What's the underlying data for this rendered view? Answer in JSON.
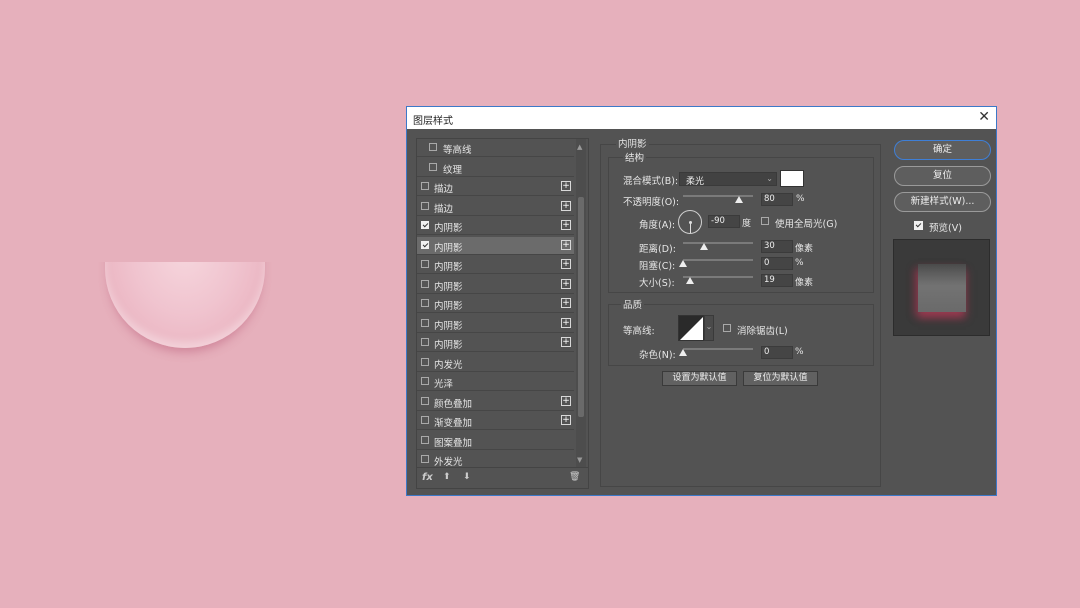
{
  "dialog": {
    "title": "图层样式",
    "close": "✕"
  },
  "styles": [
    {
      "label": "等高线",
      "checked": false,
      "plus": false,
      "indent": true
    },
    {
      "label": "纹理",
      "checked": false,
      "plus": false,
      "indent": true
    },
    {
      "label": "描边",
      "checked": false,
      "plus": true
    },
    {
      "label": "描边",
      "checked": false,
      "plus": true
    },
    {
      "label": "内阴影",
      "checked": true,
      "plus": true
    },
    {
      "label": "内阴影",
      "checked": true,
      "plus": true,
      "selected": true
    },
    {
      "label": "内阴影",
      "checked": false,
      "plus": true
    },
    {
      "label": "内阴影",
      "checked": false,
      "plus": true
    },
    {
      "label": "内阴影",
      "checked": false,
      "plus": true
    },
    {
      "label": "内阴影",
      "checked": false,
      "plus": true
    },
    {
      "label": "内阴影",
      "checked": false,
      "plus": true
    },
    {
      "label": "内发光",
      "checked": false,
      "plus": false
    },
    {
      "label": "光泽",
      "checked": false,
      "plus": false
    },
    {
      "label": "颜色叠加",
      "checked": false,
      "plus": true
    },
    {
      "label": "渐变叠加",
      "checked": false,
      "plus": true
    },
    {
      "label": "图案叠加",
      "checked": false,
      "plus": false
    },
    {
      "label": "外发光",
      "checked": false,
      "plus": false
    }
  ],
  "list_footer": {
    "fx": "fx",
    "up": "⬆",
    "down": "⬇",
    "trash": "🗑"
  },
  "panel": {
    "title": "内阴影",
    "structure": {
      "title": "结构",
      "blend_mode_label": "混合模式(B):",
      "blend_mode_value": "柔光",
      "opacity_label": "不透明度(O):",
      "opacity_value": "80",
      "opacity_unit": "%",
      "opacity_fraction": 0.8,
      "angle_label": "角度(A):",
      "angle_value": "-90",
      "angle_unit": "度",
      "global_light_label": "使用全局光(G)",
      "distance_label": "距离(D):",
      "distance_value": "30",
      "distance_unit": "像素",
      "distance_fraction": 0.3,
      "choke_label": "阻塞(C):",
      "choke_value": "0",
      "choke_unit": "%",
      "choke_fraction": 0,
      "size_label": "大小(S):",
      "size_value": "19",
      "size_unit": "像素",
      "size_fraction": 0.1
    },
    "quality": {
      "title": "品质",
      "contour_label": "等高线:",
      "antialias_label": "消除锯齿(L)",
      "noise_label": "杂色(N):",
      "noise_value": "0",
      "noise_unit": "%",
      "noise_fraction": 0
    },
    "set_default": "设置为默认值",
    "reset_default": "复位为默认值"
  },
  "actions": {
    "ok": "确定",
    "reset": "复位",
    "new_style": "新建样式(W)...",
    "preview_label": "预览(V)"
  }
}
